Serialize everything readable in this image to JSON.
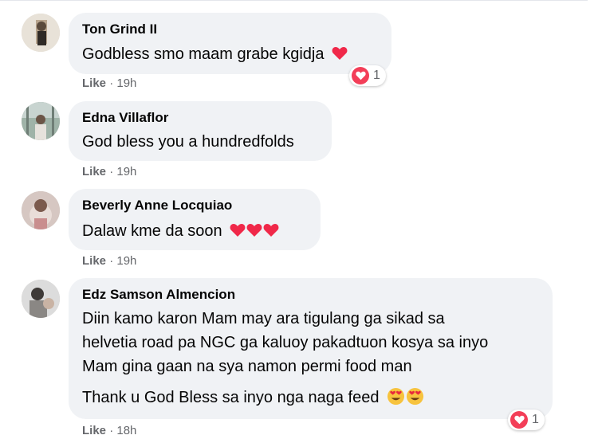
{
  "comments": [
    {
      "name": "Ton Grind II",
      "lines": [
        "Godbless smo maam grabe kgidja"
      ],
      "emoji": "heart",
      "like": "Like",
      "time": "19h",
      "reaction_count": "1"
    },
    {
      "name": "Edna Villaflor",
      "lines": [
        "God bless you a hundredfolds"
      ],
      "like": "Like",
      "time": "19h"
    },
    {
      "name": "Beverly Anne Locquiao",
      "lines": [
        "Dalaw kme da soon"
      ],
      "emoji": "three-hearts",
      "like": "Like",
      "time": "19h"
    },
    {
      "name": "Edz Samson Almencion",
      "lines": [
        "Diin kamo karon Mam may ara tigulang ga sikad sa",
        "helvetia road pa NGC ga kaluoy pakadtuon kosya sa inyo",
        "Mam gina gaan na sya namon permi food man",
        "Thank u God Bless sa inyo nga naga feed"
      ],
      "emoji": "heart-eyes",
      "like": "Like",
      "time": "18h",
      "reaction_count": "1"
    }
  ],
  "colors": {
    "bubble": "#f0f2f5",
    "meta_text": "#65676b",
    "heart": "#f02849",
    "love_badge": "#f33e58"
  }
}
